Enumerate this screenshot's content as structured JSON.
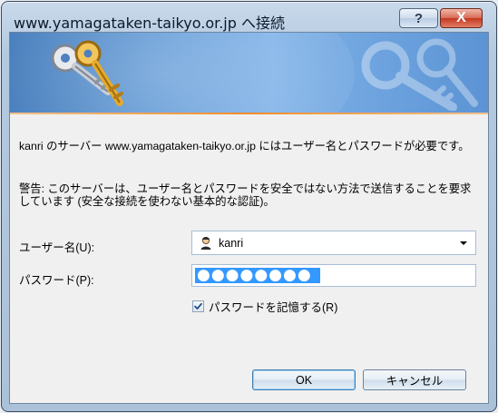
{
  "window": {
    "title": "www.yamagataken-taikyo.or.jp へ接続",
    "help_glyph": "?",
    "close_glyph": "X"
  },
  "message": {
    "line1": "kanri のサーバー www.yamagataken-taikyo.or.jp にはユーザー名とパスワードが必要です。",
    "line2": "警告: このサーバーは、ユーザー名とパスワードを安全ではない方法で送信することを要求しています (安全な接続を使わない基本的な認証)。"
  },
  "form": {
    "username_label": "ユーザー名(U):",
    "username_value": "kanri",
    "password_label": "パスワード(P):",
    "password_mask": "●●●●●●●●",
    "remember_label": "パスワードを記憶する(R)",
    "remember_checked": true
  },
  "buttons": {
    "ok": "OK",
    "cancel": "キャンセル"
  },
  "icons": {
    "banner": "keys-icon",
    "user": "user-icon",
    "dropdown": "chevron-down-icon",
    "check": "checkmark-icon"
  }
}
